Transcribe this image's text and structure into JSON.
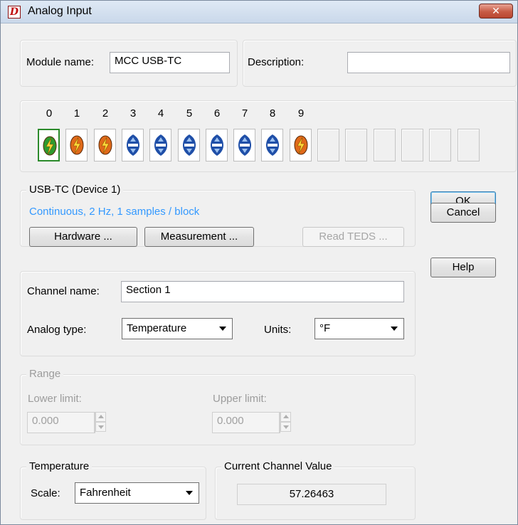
{
  "window": {
    "title": "Analog Input",
    "app_icon_letter": "D",
    "close_glyph": "✕"
  },
  "module": {
    "name_label": "Module name:",
    "name_value": "MCC USB-TC",
    "description_label": "Description:",
    "description_value": ""
  },
  "channels": {
    "numbers": [
      "0",
      "1",
      "2",
      "3",
      "4",
      "5",
      "6",
      "7",
      "8",
      "9"
    ],
    "kinds": [
      "active-green",
      "active-orange",
      "active-orange",
      "inactive",
      "inactive",
      "inactive",
      "inactive",
      "inactive",
      "inactive",
      "active-orange"
    ],
    "selected_index": 0,
    "empty_slots": 6
  },
  "device": {
    "group_label": "USB-TC (Device 1)",
    "status": "Continuous, 2 Hz, 1 samples / block",
    "hardware_button": "Hardware ...",
    "measurement_button": "Measurement ...",
    "read_teds_button": "Read TEDS ..."
  },
  "dialog_buttons": {
    "ok": "OK",
    "cancel": "Cancel",
    "help": "Help"
  },
  "channel": {
    "name_label": "Channel name:",
    "name_value": "Section 1",
    "type_label": "Analog type:",
    "type_value": "Temperature",
    "units_label": "Units:",
    "units_value": "°F"
  },
  "range": {
    "group_label": "Range",
    "lower_label": "Lower limit:",
    "lower_value": "0.000",
    "upper_label": "Upper limit:",
    "upper_value": "0.000"
  },
  "temperature": {
    "group_label": "Temperature",
    "scale_label": "Scale:",
    "scale_value": "Fahrenheit"
  },
  "current": {
    "group_label": "Current Channel Value",
    "value": "57.26463"
  },
  "colors": {
    "title_gradient": "#dfe9f5",
    "close_red": "#c75b45",
    "status_blue": "#3399ff",
    "green_channel": "#2e9a2e",
    "orange_channel": "#e06a1a",
    "blue_channel": "#1f4fa8"
  }
}
